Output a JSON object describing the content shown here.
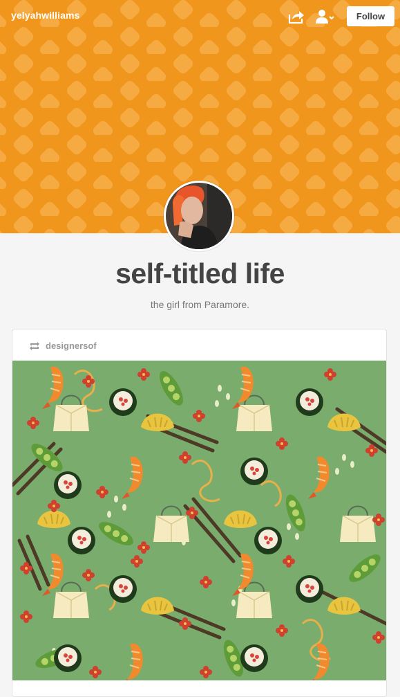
{
  "topbar": {
    "blog_name": "yelyahwilliams",
    "follow_label": "Follow",
    "icons": [
      "share-icon",
      "user-menu-icon"
    ]
  },
  "header": {
    "background_color": "#f0961c",
    "pattern_color": "#f5b04a"
  },
  "blog": {
    "title": "self-titled life",
    "description": "the girl from Paramore."
  },
  "post": {
    "reblog_icon": "reblog-icon",
    "reblogged_from": "designersof",
    "image_description_icon": "food-pattern-illustration"
  }
}
